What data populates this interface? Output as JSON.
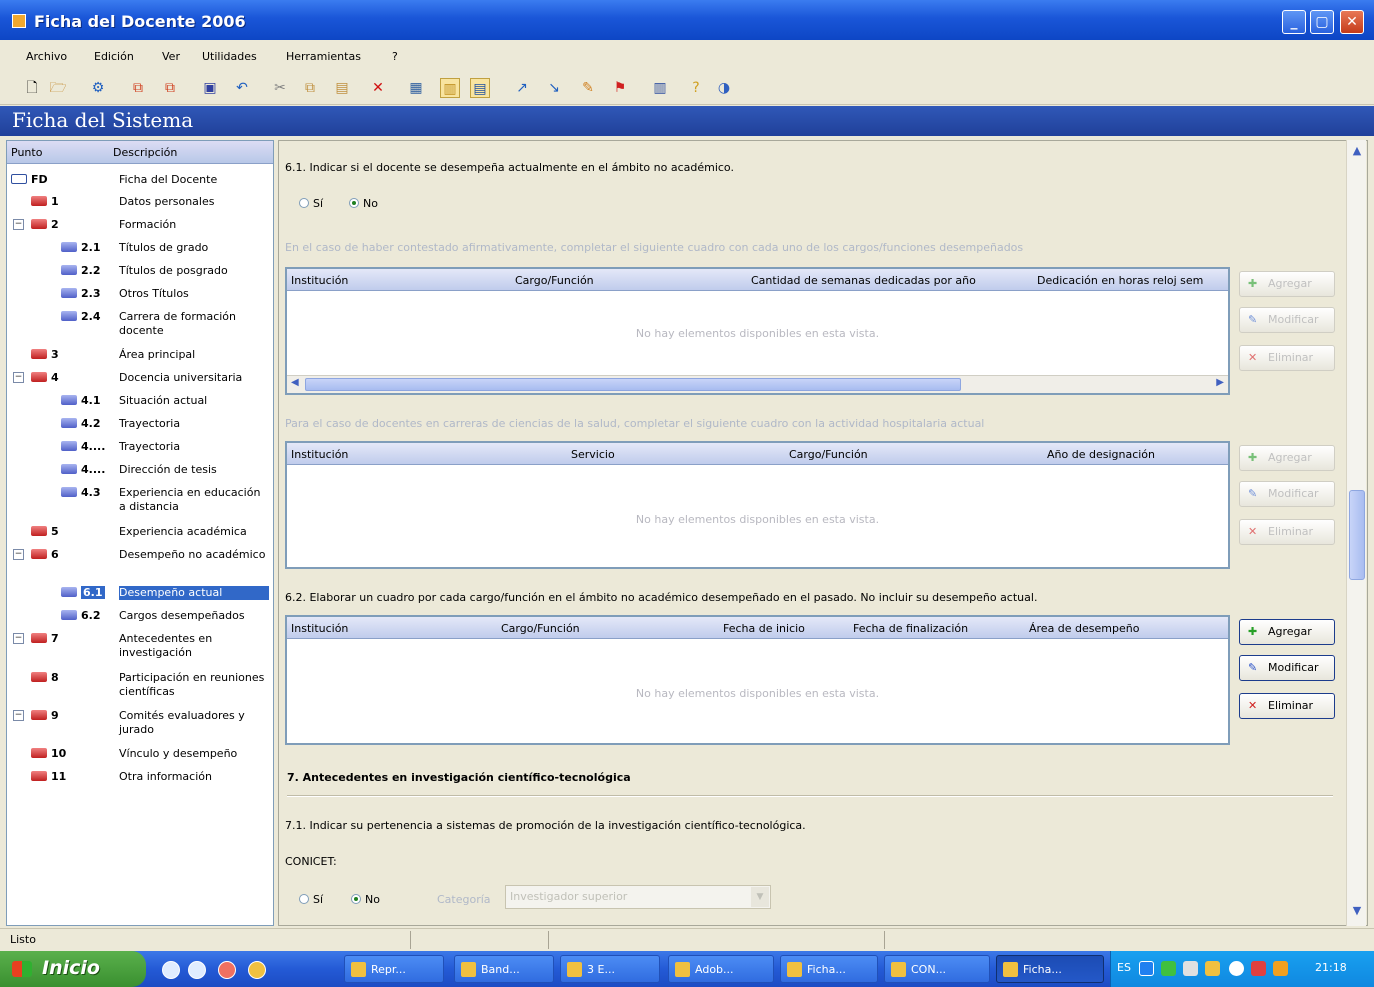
{
  "window": {
    "title": "Ficha del Docente 2006"
  },
  "menu": [
    "Archivo",
    "Edición",
    "Ver",
    "Utilidades",
    "Herramientas",
    "?"
  ],
  "section_title": "Ficha del Sistema",
  "tree": {
    "col_punto": "Punto",
    "col_desc": "Descripción",
    "items": [
      {
        "num": "FD",
        "desc": "Ficha del Docente"
      },
      {
        "num": "1",
        "desc": "Datos personales"
      },
      {
        "num": "2",
        "desc": "Formación"
      },
      {
        "num": "2.1",
        "desc": "Títulos de grado"
      },
      {
        "num": "2.2",
        "desc": "Títulos de posgrado"
      },
      {
        "num": "2.3",
        "desc": "Otros Títulos"
      },
      {
        "num": "2.4",
        "desc": "Carrera de formación docente"
      },
      {
        "num": "3",
        "desc": "Área principal"
      },
      {
        "num": "4",
        "desc": "Docencia universitaria"
      },
      {
        "num": "4.1",
        "desc": "Situación actual"
      },
      {
        "num": "4.2",
        "desc": "Trayectoria"
      },
      {
        "num": "4....",
        "desc": "Trayectoria"
      },
      {
        "num": "4....",
        "desc": "Dirección de tesis"
      },
      {
        "num": "4.3",
        "desc": "Experiencia en educación a distancia"
      },
      {
        "num": "5",
        "desc": "Experiencia académica"
      },
      {
        "num": "6",
        "desc": "Desempeño no académico"
      },
      {
        "num": "6.1",
        "desc": "Desempeño actual"
      },
      {
        "num": "6.2",
        "desc": "Cargos desempeñados"
      },
      {
        "num": "7",
        "desc": "Antecedentes en investigación"
      },
      {
        "num": "8",
        "desc": "Participación en reuniones científicas"
      },
      {
        "num": "9",
        "desc": "Comités evaluadores y jurado"
      },
      {
        "num": "10",
        "desc": "Vínculo y desempeño"
      },
      {
        "num": "11",
        "desc": "Otra información"
      }
    ]
  },
  "content": {
    "q61": "6.1. Indicar si el docente se desempeña actualmente en el ámbito no académico.",
    "si": "Sí",
    "no": "No",
    "hint1": "En el caso de haber contestado afirmativamente, completar el siguiente cuadro con cada uno de los cargos/funciones desempeñados",
    "hint2": "Para el caso de docentes en carreras de ciencias de la salud, completar el siguiente cuadro con la actividad hospitalaria actual",
    "grid1_cols": [
      "Institución",
      "Cargo/Función",
      "Cantidad de semanas dedicadas por año",
      "Dedicación en horas reloj sem"
    ],
    "grid2_cols": [
      "Institución",
      "Servicio",
      "Cargo/Función",
      "Año de designación"
    ],
    "q62": "6.2. Elaborar un cuadro por cada cargo/función en el ámbito no académico desempeñado en el pasado. No incluir su desempeño actual.",
    "grid3_cols": [
      "Institución",
      "Cargo/Función",
      "Fecha de inicio",
      "Fecha de finalización",
      "Área de desempeño"
    ],
    "empty": "No hay elementos disponibles en esta vista.",
    "btn_add": "Agregar",
    "btn_edit": "Modificar",
    "btn_del": "Eliminar",
    "h7": "7. Antecedentes en investigación científico-tecnológica",
    "q71": "7.1. Indicar su pertenencia a sistemas de promoción de la investigación científico-tecnológica.",
    "conicet": "CONICET:",
    "categoria_label": "Categoría",
    "categoria_value": "Investigador superior"
  },
  "status": "Listo",
  "taskbar": {
    "start": "Inicio",
    "tasks": [
      "Repr...",
      "Band...",
      "3 E...",
      "Adob...",
      "Ficha...",
      "CON...",
      "Ficha..."
    ],
    "lang": "ES",
    "clock": "21:18"
  }
}
